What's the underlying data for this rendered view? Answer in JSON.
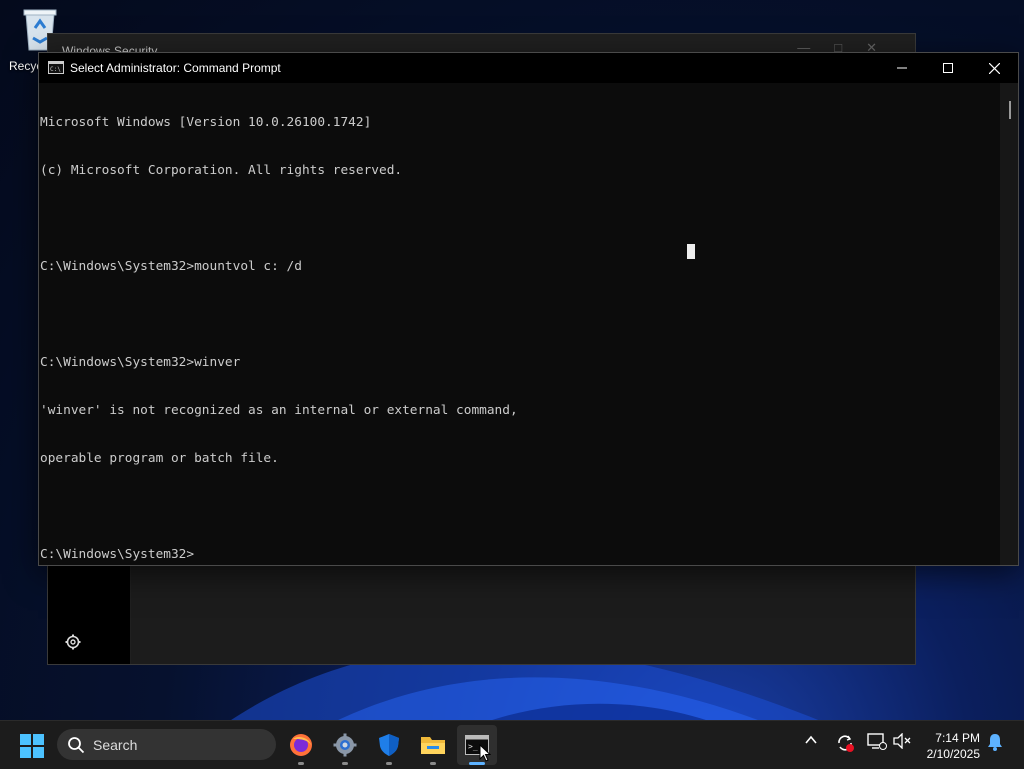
{
  "desktop": {
    "recycle_bin_label": "Recycle Bin"
  },
  "background_window": {
    "title": "Windows Security"
  },
  "cmd_window": {
    "title": "Select Administrator: Command Prompt",
    "lines": [
      "Microsoft Windows [Version 10.0.26100.1742]",
      "(c) Microsoft Corporation. All rights reserved.",
      "",
      "C:\\Windows\\System32>mountvol c: /d",
      "",
      "C:\\Windows\\System32>winver",
      "'winver' is not recognized as an internal or external command,",
      "operable program or batch file.",
      "",
      "C:\\Windows\\System32>"
    ]
  },
  "taskbar": {
    "search_placeholder": "Search",
    "apps": [
      {
        "name": "firefox-icon",
        "active": false
      },
      {
        "name": "settings-icon",
        "active": false
      },
      {
        "name": "windows-security-icon",
        "active": false
      },
      {
        "name": "file-explorer-icon",
        "active": false
      },
      {
        "name": "command-prompt-icon",
        "active": true
      }
    ],
    "clock": {
      "time": "7:14 PM",
      "date": "2/10/2025"
    }
  },
  "colors": {
    "console_bg": "#0c0c0c",
    "console_text": "#cccccc",
    "taskbar_bg": "#1c1c1c",
    "accent": "#5db2ff"
  }
}
